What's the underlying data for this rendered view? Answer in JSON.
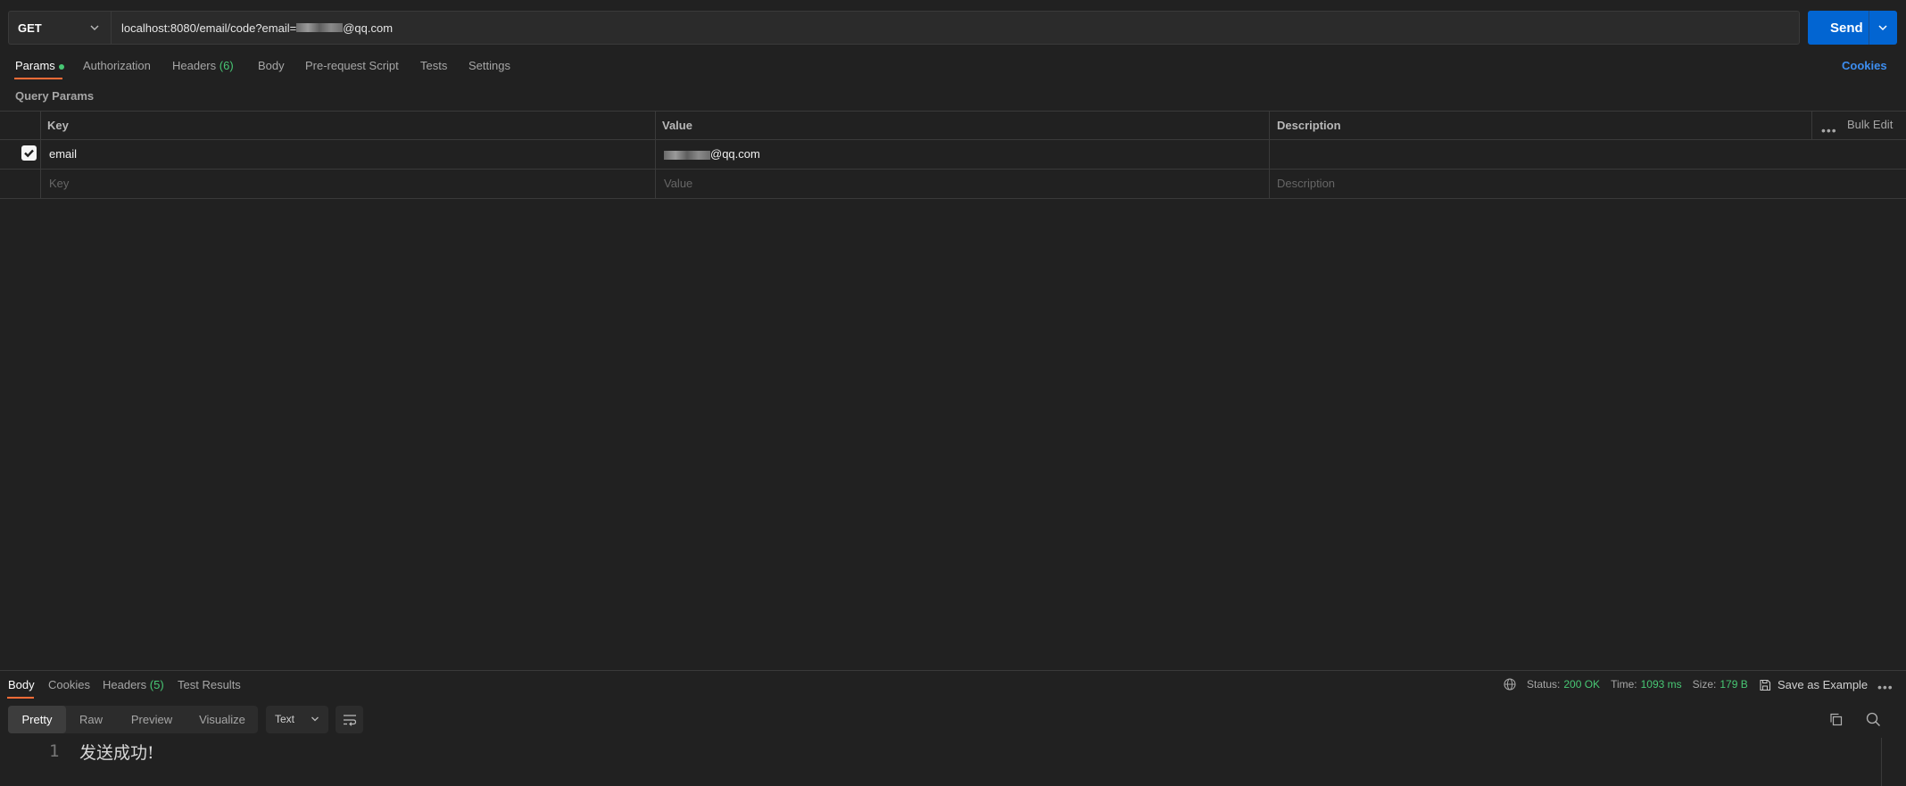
{
  "request": {
    "method": "GET",
    "url_prefix": "localhost:8080/email/code?email=",
    "url_suffix": "@qq.com",
    "send_label": "Send"
  },
  "request_tabs": {
    "params": "Params",
    "authorization": "Authorization",
    "headers": "Headers",
    "headers_count": "(6)",
    "body": "Body",
    "pre_request": "Pre-request Script",
    "tests": "Tests",
    "settings": "Settings",
    "cookies": "Cookies"
  },
  "query_params": {
    "section_label": "Query Params",
    "columns": {
      "key": "Key",
      "value": "Value",
      "description": "Description"
    },
    "bulk_edit": "Bulk Edit",
    "rows": [
      {
        "checked": true,
        "key": "email",
        "value_prefix": "",
        "value_suffix": "@qq.com",
        "description": ""
      }
    ],
    "placeholders": {
      "key": "Key",
      "value": "Value",
      "description": "Description"
    }
  },
  "response": {
    "tabs": {
      "body": "Body",
      "cookies": "Cookies",
      "headers": "Headers",
      "headers_count": "(5)",
      "test_results": "Test Results"
    },
    "status_label": "Status:",
    "status_value": "200 OK",
    "time_label": "Time:",
    "time_value": "1093 ms",
    "size_label": "Size:",
    "size_value": "179 B",
    "save_example": "Save as Example",
    "views": {
      "pretty": "Pretty",
      "raw": "Raw",
      "preview": "Preview",
      "visualize": "Visualize"
    },
    "format": "Text",
    "line_number": "1",
    "body_text": "发送成功!"
  },
  "colors": {
    "accent_orange": "#ff6c37",
    "send_blue": "#0265d2",
    "status_green": "#48c774",
    "link_blue": "#3d8ef0",
    "background": "#212121"
  }
}
